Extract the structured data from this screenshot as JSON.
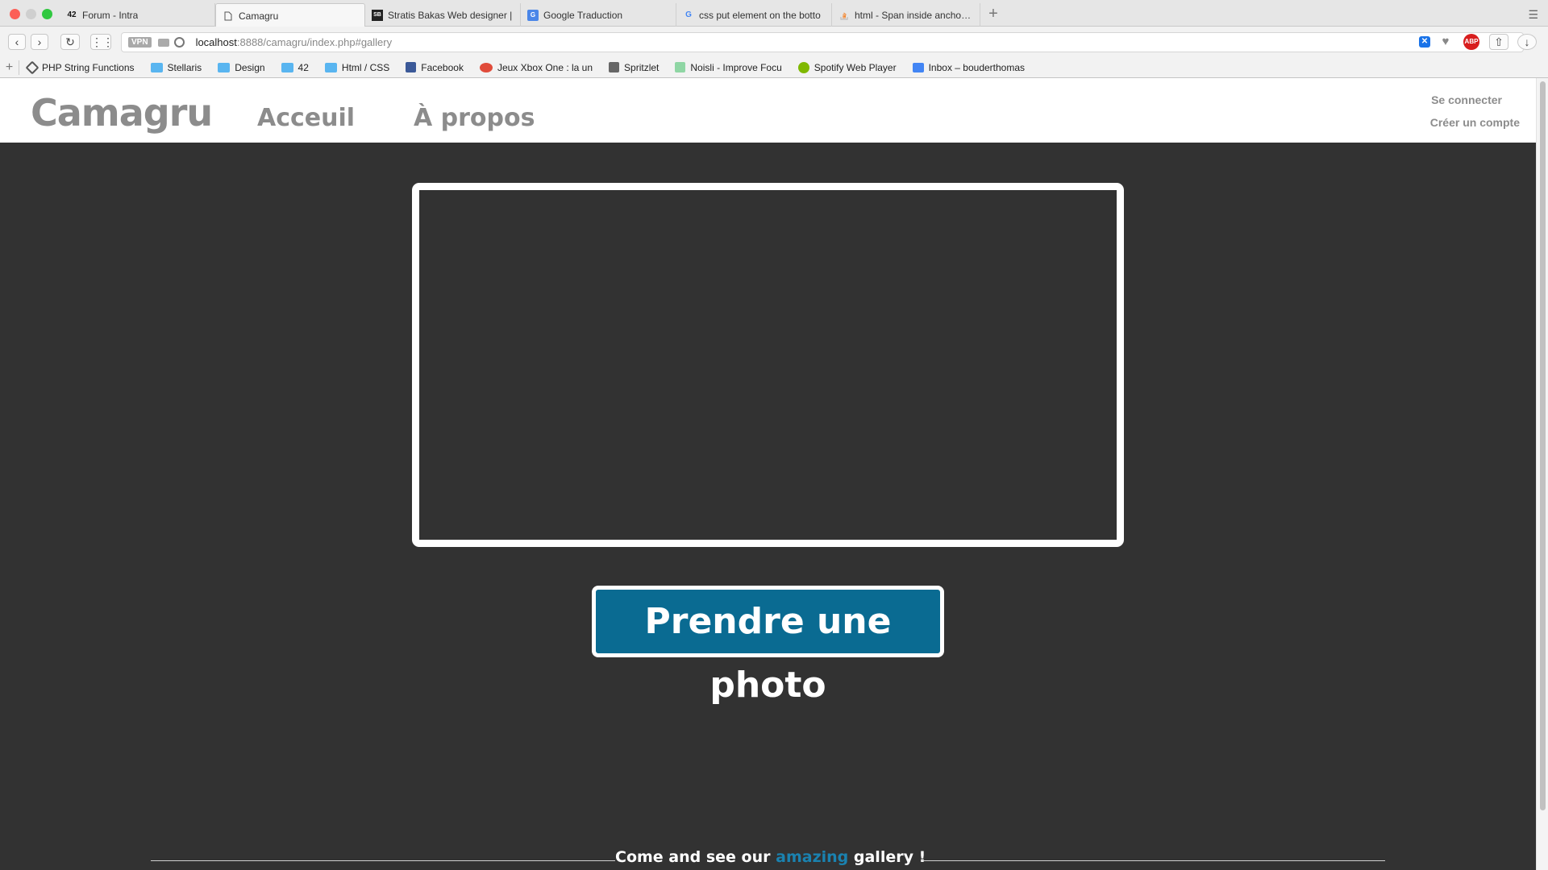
{
  "browser": {
    "tabs": [
      {
        "label": "Forum - Intra",
        "icon": "42-logo-icon"
      },
      {
        "label": "Camagru",
        "icon": "page-icon"
      },
      {
        "label": "Stratis Bakas Web designer |",
        "icon": "sb-logo-icon"
      },
      {
        "label": "Google Traduction",
        "icon": "google-translate-icon"
      },
      {
        "label": "css put element on the botto",
        "icon": "google-icon"
      },
      {
        "label": "html - Span inside anchor or",
        "icon": "stackoverflow-icon"
      }
    ],
    "new_tab": "+",
    "url_vpn": "VPN",
    "url_host": "localhost",
    "url_rest": ":8888/camagru/index.php#gallery",
    "ext_abp": "ABP",
    "bookmarks": [
      {
        "label": "PHP String Functions",
        "icon": "php-icon"
      },
      {
        "label": "Stellaris",
        "icon": "folder-icon"
      },
      {
        "label": "Design",
        "icon": "folder-icon"
      },
      {
        "label": "42",
        "icon": "folder-icon"
      },
      {
        "label": "Html / CSS",
        "icon": "folder-icon"
      },
      {
        "label": "Facebook",
        "icon": "facebook-icon"
      },
      {
        "label": "Jeux Xbox One : la un",
        "icon": "gamepad-icon"
      },
      {
        "label": "Spritzlet",
        "icon": "star-icon"
      },
      {
        "label": "Noisli - Improve Focu",
        "icon": "noisli-icon"
      },
      {
        "label": "Spotify Web Player",
        "icon": "spotify-icon"
      },
      {
        "label": "Inbox – bouderthomas",
        "icon": "inbox-icon"
      }
    ]
  },
  "site": {
    "logo": "Camagru",
    "nav": {
      "home": "Acceuil",
      "about": "À propos"
    },
    "auth": {
      "login": "Se connecter",
      "signup": "Créer un compte"
    },
    "capture_button": "Prendre une photo",
    "gallery_banner": {
      "before": "Come and see our ",
      "accent": "amazing",
      "after": " gallery !"
    }
  },
  "colors": {
    "background": "#323232",
    "accent": "#0a6b92",
    "nav_text": "#8c8c8c"
  }
}
